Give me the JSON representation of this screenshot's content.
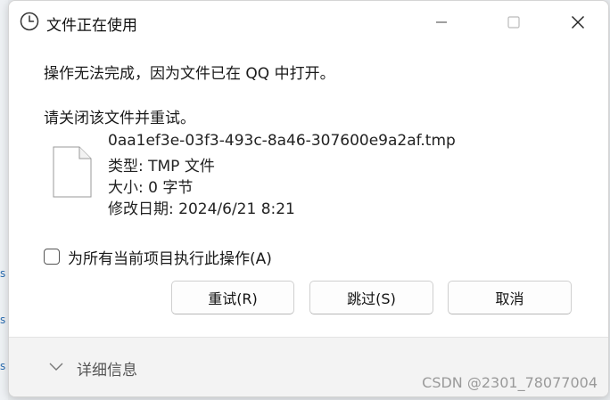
{
  "window": {
    "title": "文件正在使用"
  },
  "message": {
    "line1": "操作无法完成，因为文件已在 QQ 中打开。",
    "line2": "请关闭该文件并重试。"
  },
  "file": {
    "name": "0aa1ef3e-03f3-493c-8a46-307600e9a2af.tmp",
    "type": "类型: TMP 文件",
    "size": "大小: 0 字节",
    "modified": "修改日期: 2024/6/21 8:21"
  },
  "checkbox": {
    "label": "为所有当前项目执行此操作(A)",
    "checked": false
  },
  "buttons": {
    "retry": "重试(R)",
    "skip": "跳过(S)",
    "cancel": "取消"
  },
  "footer": {
    "details": "详细信息"
  },
  "watermark": "CSDN @2301_78077004",
  "icons": [
    "clock-icon",
    "minimize-icon",
    "maximize-icon",
    "close-icon",
    "file-icon",
    "chevron-down-icon"
  ]
}
